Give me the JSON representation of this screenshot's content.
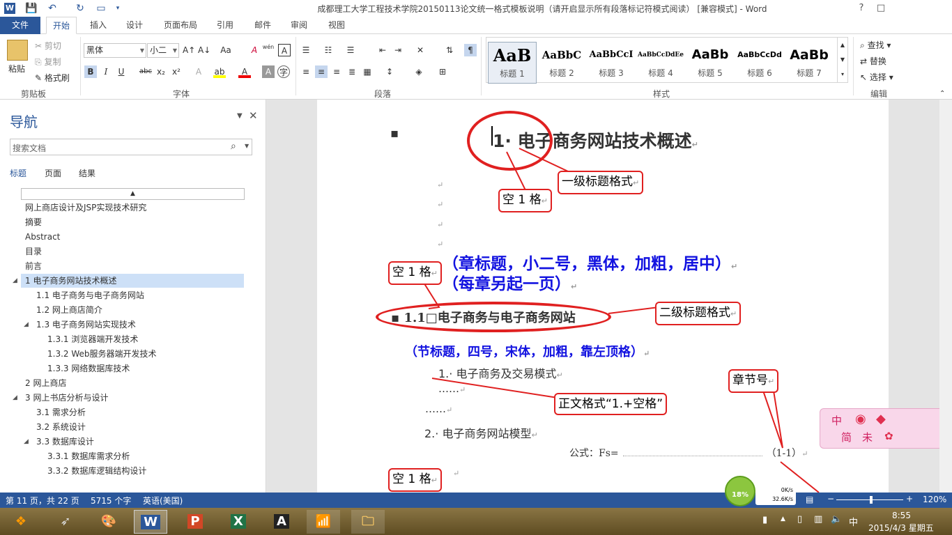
{
  "window": {
    "title": "成都理工大学工程技术学院20150113论文统一格式模板说明（请开启显示所有段落标记符模式阅读） [兼容模式] - Word",
    "help": "?",
    "restore": "□",
    "minimize": "—",
    "close": "✕",
    "word_icon": "W"
  },
  "tabs": [
    "文件",
    "开始",
    "插入",
    "设计",
    "页面布局",
    "引用",
    "邮件",
    "审阅",
    "视图"
  ],
  "ribbon": {
    "clipboard": {
      "paste": "粘贴",
      "cut": "剪切",
      "copy": "复制",
      "format_painter": "格式刷",
      "group": "剪贴板"
    },
    "font": {
      "name": "黑体",
      "size": "小二",
      "group": "字体",
      "bold": "B",
      "italic": "I",
      "underline": "U",
      "strike": "abc",
      "sub": "x₂",
      "sup": "x²",
      "grow": "A↑",
      "shrink": "A↓",
      "case": "Aa",
      "clear": "A",
      "wen": "wén",
      "border_a": "A"
    },
    "paragraph": {
      "group": "段落"
    },
    "styles": {
      "group": "样式",
      "items": [
        {
          "preview": "AaB",
          "name": "标题 1"
        },
        {
          "preview": "AaBbC",
          "name": "标题 2"
        },
        {
          "preview": "AaBbCcI",
          "name": "标题 3"
        },
        {
          "preview": "AaBbCcDdEe",
          "name": "标题 4"
        },
        {
          "preview": "AaBb",
          "name": "标题 5"
        },
        {
          "preview": "AaBbCcDd",
          "name": "标题 6"
        },
        {
          "preview": "AaBb",
          "name": "标题 7"
        }
      ]
    },
    "editing": {
      "find": "查找",
      "replace": "替换",
      "select": "选择",
      "group": "编辑"
    }
  },
  "nav": {
    "title": "导航",
    "search_placeholder": "搜索文档",
    "tabs": [
      "标题",
      "页面",
      "结果"
    ],
    "items": [
      {
        "text": "网上商店设计及JSP实现技术研究",
        "level": 0
      },
      {
        "text": "摘要",
        "level": 0
      },
      {
        "text": "Abstract",
        "level": 0
      },
      {
        "text": "目录",
        "level": 0
      },
      {
        "text": "前言",
        "level": 0
      },
      {
        "text": "1 电子商务网站技术概述",
        "level": 0,
        "expanded": true,
        "selected": true
      },
      {
        "text": "1.1 电子商务与电子商务网站",
        "level": 1
      },
      {
        "text": "1.2 网上商店简介",
        "level": 1
      },
      {
        "text": "1.3 电子商务网站实现技术",
        "level": 1,
        "expanded": true
      },
      {
        "text": "1.3.1 浏览器端开发技术",
        "level": 2
      },
      {
        "text": "1.3.2 Web服务器端开发技术",
        "level": 2
      },
      {
        "text": "1.3.3 网络数据库技术",
        "level": 2
      },
      {
        "text": "2 网上商店",
        "level": 0
      },
      {
        "text": "3 网上书店分析与设计",
        "level": 0,
        "expanded": true
      },
      {
        "text": "3.1 需求分析",
        "level": 1
      },
      {
        "text": "3.2 系统设计",
        "level": 1
      },
      {
        "text": "3.3 数据库设计",
        "level": 1,
        "expanded": true
      },
      {
        "text": "3.3.1 数据库需求分析",
        "level": 2
      },
      {
        "text": "3.3.2 数据库逻辑结构设计",
        "level": 2
      }
    ]
  },
  "doc": {
    "chapter_heading": "1· 电子商务网站技术概述",
    "callout_level1": "一级标题格式",
    "callout_space1": "空 1 格",
    "blue1": "（章标题，小二号，黑体，加粗，居中）",
    "blue2": "（每章另起一页）",
    "callout_space2": "空 1 格",
    "section_heading": "1.1□电子商务与电子商务网站",
    "callout_level2": "二级标题格式",
    "blue3": "（节标题，四号，宋体，加粗，靠左顶格）",
    "body1": "1.· 电子商务及交易模式",
    "dots1": "……",
    "dots2": "……",
    "callout_body": "正文格式“1.+空格”",
    "callout_chapter_no": "章节号",
    "body2": "2.· 电子商务网站模型",
    "formula": "公式：Fs=",
    "formula_no": "（1-1）",
    "callout_space3": "空 1 格",
    "para_mark": "↵"
  },
  "widget": {
    "chars": [
      "中",
      "简",
      "未"
    ],
    "percent": "18%",
    "up": "0K/s",
    "down": "32.6K/s"
  },
  "status": {
    "page": "第 11 页，共 22 页",
    "words": "5715 个字",
    "lang": "英语(美国)",
    "zoom": "120%"
  },
  "taskbar": {
    "time": "8:55",
    "date": "2015/4/3 星期五",
    "ime": "中"
  }
}
